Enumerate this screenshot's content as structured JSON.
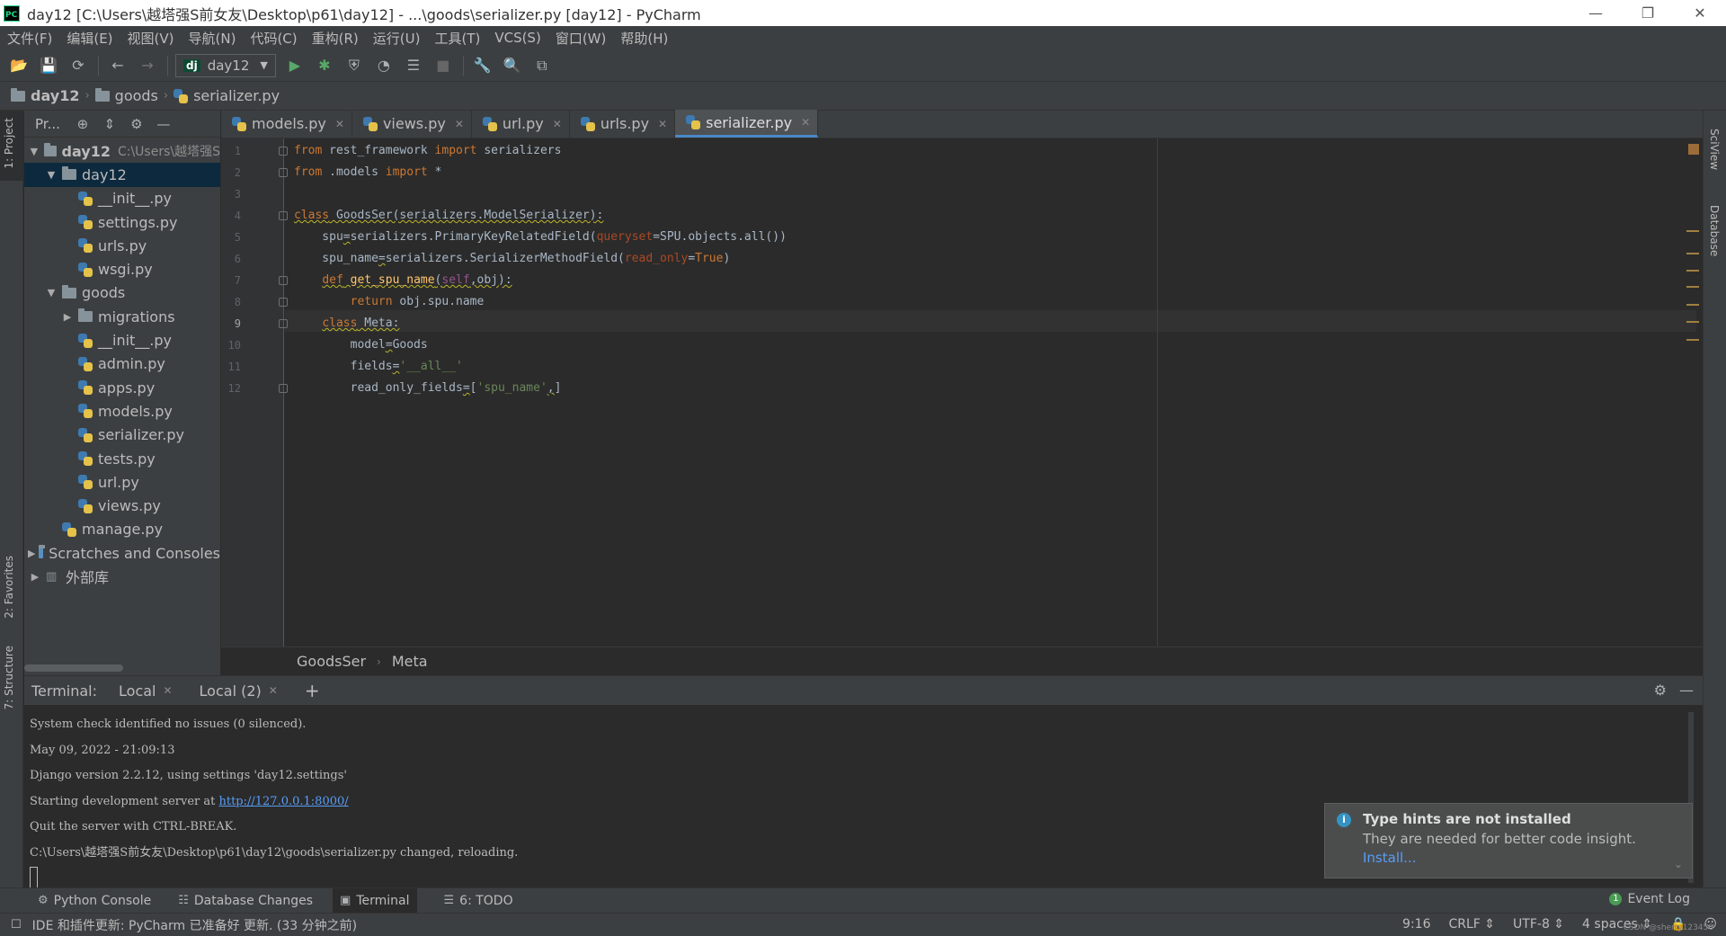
{
  "window": {
    "title": "day12 [C:\\Users\\越塔强S前女友\\Desktop\\p61\\day12] - ...\\goods\\serializer.py [day12] - PyCharm",
    "app_icon_text": "PC"
  },
  "menu": [
    "文件(F)",
    "编辑(E)",
    "视图(V)",
    "导航(N)",
    "代码(C)",
    "重构(R)",
    "运行(U)",
    "工具(T)",
    "VCS(S)",
    "窗口(W)",
    "帮助(H)"
  ],
  "toolbar": {
    "run_config": "day12",
    "run_config_badge": "dj"
  },
  "breadcrumb": {
    "items": [
      "day12",
      "goods",
      "serializer.py"
    ]
  },
  "left_strip": {
    "project": "1: Project",
    "favorites": "2: Favorites",
    "structure": "7: Structure"
  },
  "right_strip": {
    "sciview": "SciView",
    "database": "Database"
  },
  "project": {
    "header_label": "Pr...",
    "root": {
      "name": "day12",
      "path": "C:\\Users\\越塔强S"
    },
    "tree": [
      {
        "name": "day12",
        "level": 1,
        "kind": "folder",
        "arrow": "▼",
        "selected": true
      },
      {
        "name": "__init__.py",
        "level": 2,
        "kind": "py"
      },
      {
        "name": "settings.py",
        "level": 2,
        "kind": "py"
      },
      {
        "name": "urls.py",
        "level": 2,
        "kind": "py"
      },
      {
        "name": "wsgi.py",
        "level": 2,
        "kind": "py"
      },
      {
        "name": "goods",
        "level": 1,
        "kind": "folder",
        "arrow": "▼"
      },
      {
        "name": "migrations",
        "level": 2,
        "kind": "folder",
        "arrow": "▶"
      },
      {
        "name": "__init__.py",
        "level": 2,
        "kind": "py"
      },
      {
        "name": "admin.py",
        "level": 2,
        "kind": "py"
      },
      {
        "name": "apps.py",
        "level": 2,
        "kind": "py"
      },
      {
        "name": "models.py",
        "level": 2,
        "kind": "py"
      },
      {
        "name": "serializer.py",
        "level": 2,
        "kind": "py"
      },
      {
        "name": "tests.py",
        "level": 2,
        "kind": "py"
      },
      {
        "name": "url.py",
        "level": 2,
        "kind": "py"
      },
      {
        "name": "views.py",
        "level": 2,
        "kind": "py"
      },
      {
        "name": "manage.py",
        "level": 1,
        "kind": "py"
      },
      {
        "name": "Scratches and Consoles",
        "level": 0,
        "kind": "scratch",
        "arrow": "▶"
      },
      {
        "name": "外部库",
        "level": 0,
        "kind": "lib",
        "arrow": "▶"
      }
    ]
  },
  "tabs": [
    {
      "label": "models.py",
      "active": false
    },
    {
      "label": "views.py",
      "active": false
    },
    {
      "label": "url.py",
      "active": false
    },
    {
      "label": "urls.py",
      "active": false
    },
    {
      "label": "serializer.py",
      "active": true
    }
  ],
  "code": {
    "lines": [
      {
        "n": "1",
        "html": "<span class=\"kw\">from</span> rest_framework <span class=\"kw\">import</span> serializers"
      },
      {
        "n": "2",
        "html": "<span class=\"kw\">from</span> .models <span class=\"kw\">import</span> *"
      },
      {
        "n": "3",
        "html": ""
      },
      {
        "n": "4",
        "html": "<span class=\"squig\"><span class=\"kw\">class</span> GoodsSer(serializers.ModelSerializer):</span>"
      },
      {
        "n": "5",
        "html": "    spu<span class=\"squig\">=</span>serializers.PrimaryKeyRelatedField(<span class=\"param\">queryset</span>=SPU.objects.all())"
      },
      {
        "n": "6",
        "html": "    spu_name<span class=\"squig\">=</span>serializers.SerializerMethodField(<span class=\"param\">read_only</span>=<span class=\"kw\">True</span>)"
      },
      {
        "n": "7",
        "html": "    <span class=\"squig\"><span class=\"kw\">def</span> <span class=\"fn\">get_spu_name</span>(<span class=\"selfc\">self</span>,obj):</span>"
      },
      {
        "n": "8",
        "html": "        <span class=\"kw\">return</span> obj.spu.name"
      },
      {
        "n": "9",
        "html": "    <span class=\"squig\"><span class=\"kw\">class</span> Meta:</span>"
      },
      {
        "n": "10",
        "html": "        model<span class=\"squig\">=</span>Goods"
      },
      {
        "n": "11",
        "html": "        fields<span class=\"squig\">=</span><span class=\"str\">'__all__'</span>"
      },
      {
        "n": "12",
        "html": "        read_only_fields<span class=\"squig\">=</span>[<span class=\"str\">'spu_name'</span><span class=\"squig\">,</span>]"
      }
    ],
    "fold_lines": [
      1,
      2,
      4,
      7,
      8,
      9,
      12
    ],
    "current_line": 9
  },
  "editor_breadcrumb": [
    "GoodsSer",
    "Meta"
  ],
  "terminal": {
    "label": "Terminal:",
    "tabs": [
      "Local",
      "Local (2)"
    ],
    "lines": [
      {
        "text": "System check identified no issues (0 silenced)."
      },
      {
        "text": "May 09, 2022 - 21:09:13"
      },
      {
        "text": "Django version 2.2.12, using settings 'day12.settings'"
      },
      {
        "text": "Starting development server at ",
        "link": "http://127.0.0.1:8000/"
      },
      {
        "text": "Quit the server with CTRL-BREAK."
      },
      {
        "text": "C:\\Users\\越塔强S前女友\\Desktop\\p61\\day12\\goods\\serializer.py changed, reloading."
      }
    ]
  },
  "notification": {
    "title": "Type hints are not installed",
    "body": "They are needed for better code insight.",
    "link": "Install..."
  },
  "bottom_tools": {
    "python_console": "Python Console",
    "database_changes": "Database Changes",
    "terminal": "Terminal",
    "todo": "6: TODO",
    "event_log": "Event Log"
  },
  "status": {
    "message": "IDE 和插件更新: PyCharm 已准备好 更新. (33 分钟之前)",
    "position": "9:16",
    "line_sep": "CRLF ⇕",
    "encoding": "UTF-8 ⇕",
    "indent": "4 spaces ⇕",
    "watermark": "CSDN @sherry123456"
  }
}
